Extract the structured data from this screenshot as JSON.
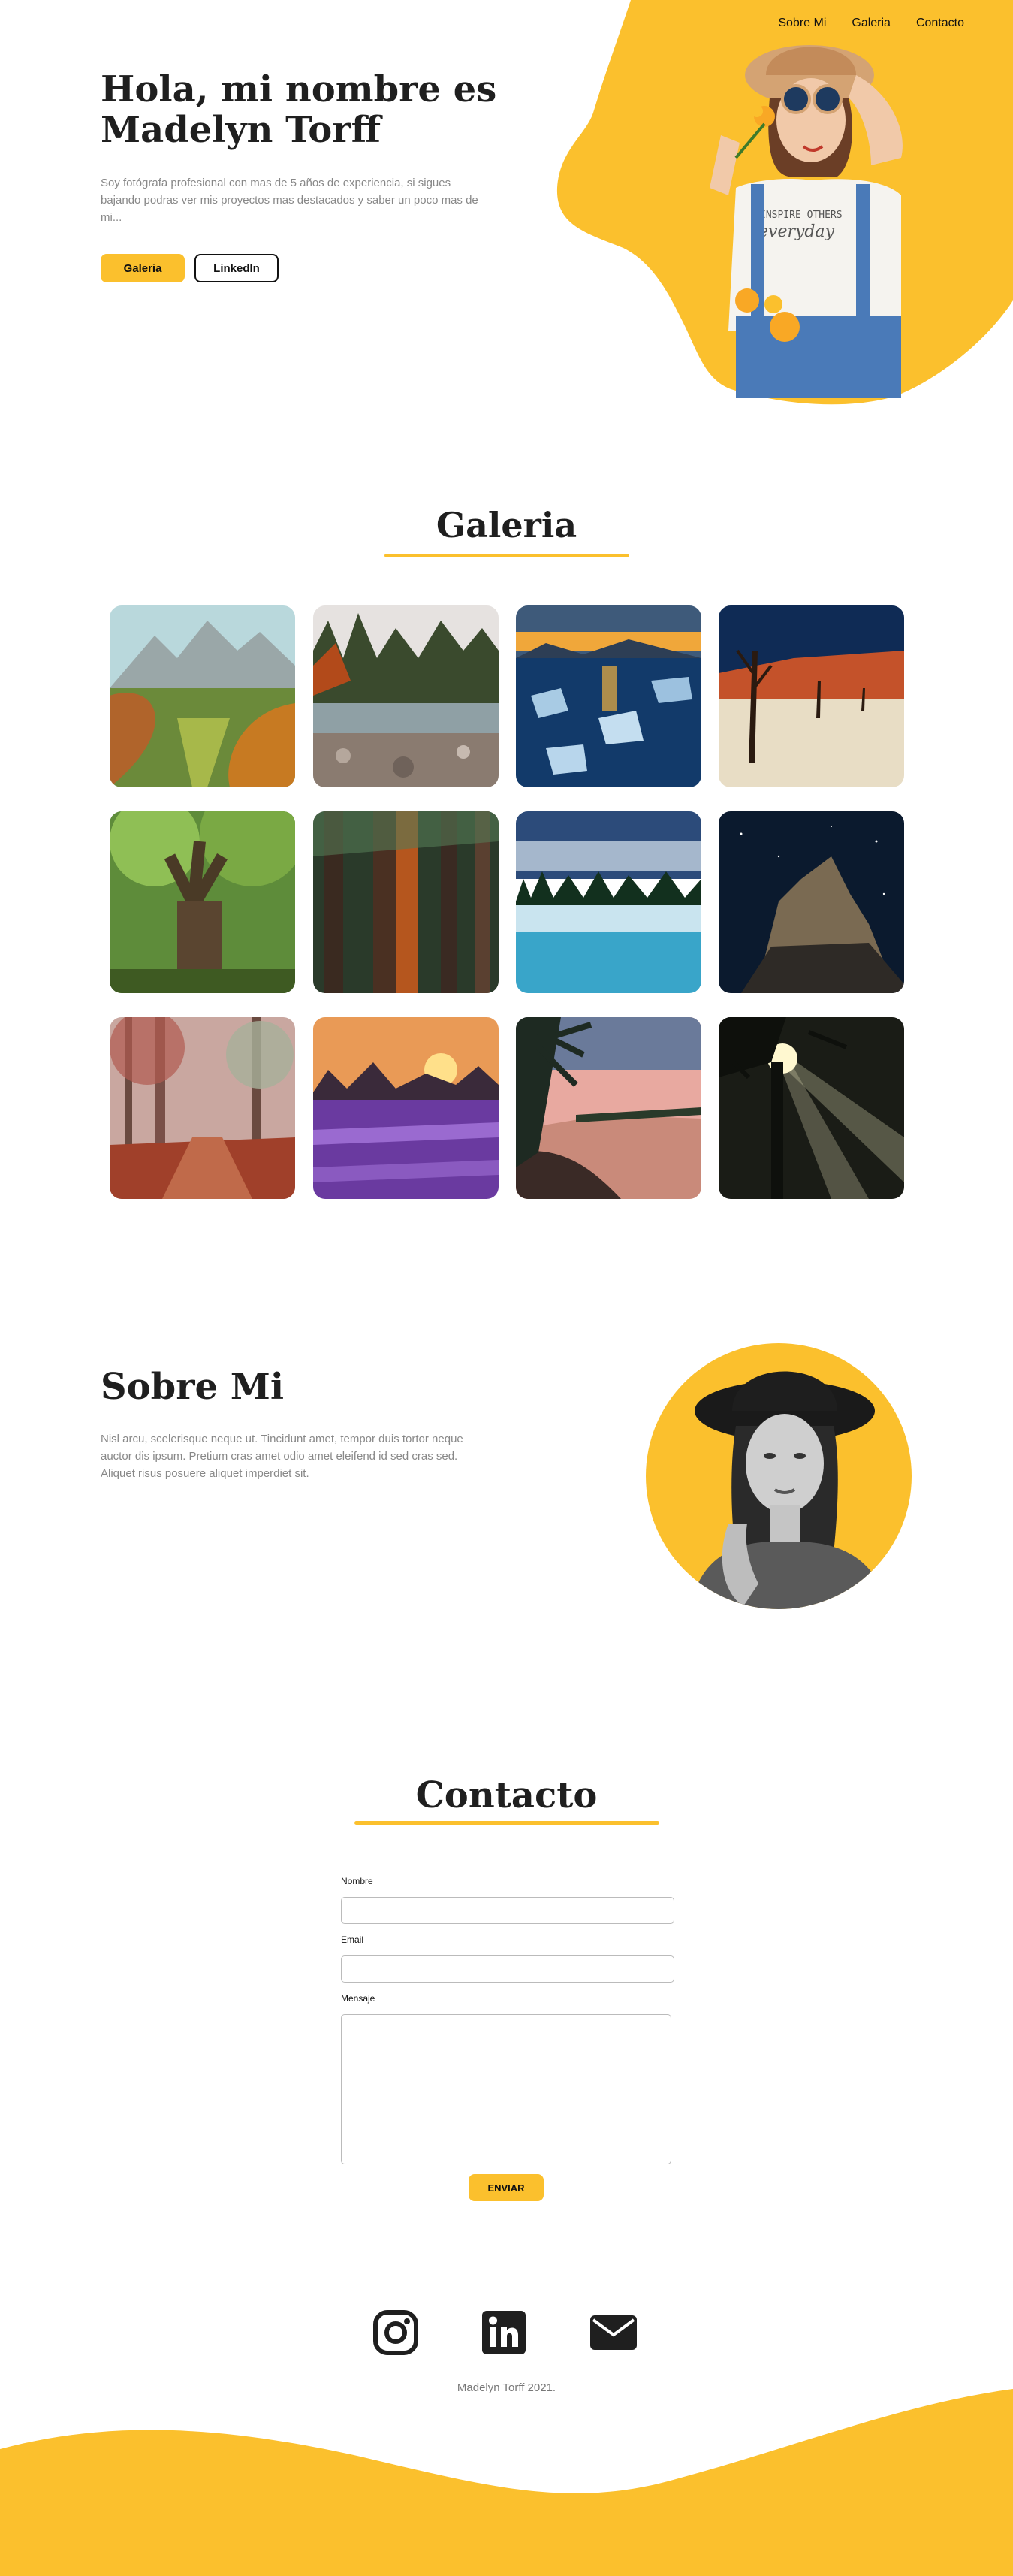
{
  "nav": {
    "items": [
      "Sobre Mi",
      "Galeria",
      "Contacto"
    ]
  },
  "hero": {
    "title": "Hola, mi nombre es Madelyn Torff",
    "description": "Soy fotógrafa profesional con mas de 5 años de experiencia, si sigues bajando podras ver mis proyectos mas destacados y saber un poco mas de mi...",
    "primary_button": "Galeria",
    "secondary_button": "LinkedIn"
  },
  "gallery": {
    "title": "Galeria",
    "photos": [
      "mountain-valley-autumn",
      "forest-lake-shore",
      "frozen-lake-sunset",
      "desert-dead-trees",
      "banyan-tree",
      "tall-redwood-forest",
      "misty-lake-forest",
      "night-rock-formation",
      "autumn-forest-path",
      "lavender-field-sunset",
      "tropical-beach-palms",
      "forest-sun-rays"
    ]
  },
  "about": {
    "title": "Sobre Mi",
    "text": "Nisl arcu, scelerisque neque ut. Tincidunt amet, tempor duis tortor neque auctor dis ipsum. Pretium cras amet odio amet eleifend id sed cras sed. Aliquet risus posuere aliquet imperdiet sit."
  },
  "contact": {
    "title": "Contacto",
    "name_label": "Nombre",
    "email_label": "Email",
    "message_label": "Mensaje",
    "submit_label": "ENVIAR"
  },
  "footer": {
    "icons": [
      "instagram-icon",
      "linkedin-icon",
      "email-icon"
    ],
    "copyright": "Madelyn Torff 2021."
  },
  "colors": {
    "accent": "#fbc02d",
    "text": "#1f1f1f",
    "muted": "#888888"
  }
}
